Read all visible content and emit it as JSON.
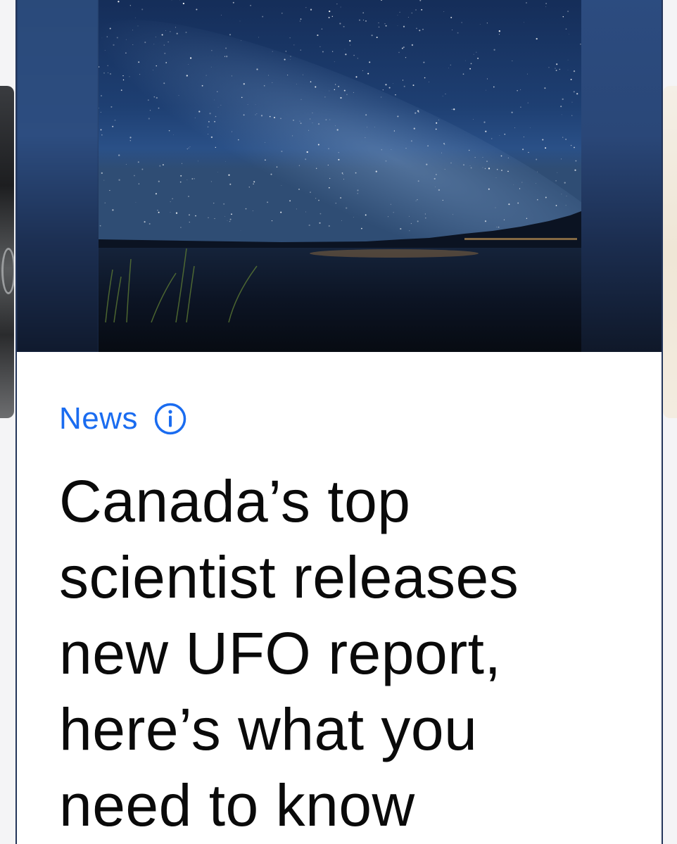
{
  "card": {
    "category": "News",
    "headline": "Canada’s top scientist releases new UFO report, here’s what you need to know"
  },
  "icons": {
    "info": "info-circle-icon"
  },
  "colors": {
    "category": "#1a6cf0",
    "headline": "#0a0a0a",
    "card_border": "#23355a",
    "sky": "#1f3a63"
  }
}
